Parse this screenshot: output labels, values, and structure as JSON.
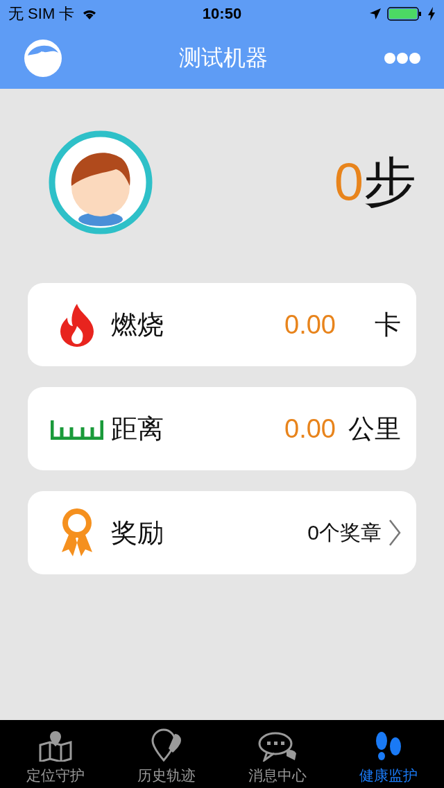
{
  "status_bar": {
    "carrier": "无 SIM 卡",
    "time": "10:50"
  },
  "nav": {
    "title": "测试机器"
  },
  "profile": {
    "steps": "0",
    "steps_unit": "步"
  },
  "cards": [
    {
      "kind": "value",
      "label": "燃烧",
      "value": "0.00",
      "unit": "卡"
    },
    {
      "kind": "value",
      "label": "距离",
      "value": "0.00",
      "unit": "公里"
    },
    {
      "kind": "link",
      "label": "奖励",
      "value": "0个奖章"
    }
  ],
  "tabs": [
    {
      "label": "定位守护",
      "selected": false
    },
    {
      "label": "历史轨迹",
      "selected": false
    },
    {
      "label": "消息中心",
      "selected": false
    },
    {
      "label": "健康监护",
      "selected": true
    }
  ]
}
